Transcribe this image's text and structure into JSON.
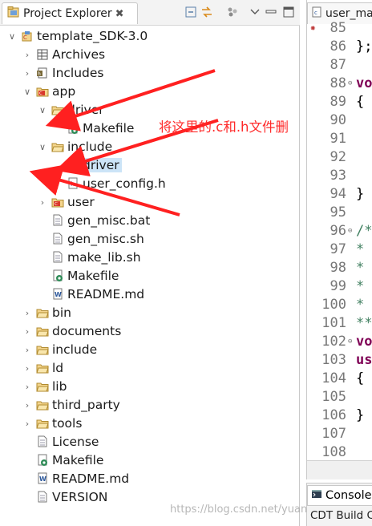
{
  "panel": {
    "title": "Project Explorer",
    "close_glyph": "✖"
  },
  "tree": [
    {
      "label": "template_SDK-3.0",
      "icon": "project-icon",
      "arrow": "∨"
    },
    {
      "label": "Archives",
      "icon": "archives-icon",
      "arrow": "›"
    },
    {
      "label": "Includes",
      "icon": "includes-icon",
      "arrow": "›"
    },
    {
      "label": "app",
      "icon": "source-folder-icon",
      "arrow": "∨"
    },
    {
      "label": "driver",
      "icon": "folder-icon",
      "arrow": "∨"
    },
    {
      "label": "Makefile",
      "icon": "makefile-icon",
      "arrow": ""
    },
    {
      "label": "include",
      "icon": "folder-icon",
      "arrow": "∨"
    },
    {
      "label": "driver",
      "icon": "folder-icon",
      "arrow": ""
    },
    {
      "label": "user_config.h",
      "icon": "header-file-icon",
      "arrow": "›"
    },
    {
      "label": "user",
      "icon": "source-folder-icon",
      "arrow": "›"
    },
    {
      "label": "gen_misc.bat",
      "icon": "file-icon",
      "arrow": ""
    },
    {
      "label": "gen_misc.sh",
      "icon": "file-icon",
      "arrow": ""
    },
    {
      "label": "make_lib.sh",
      "icon": "file-icon",
      "arrow": ""
    },
    {
      "label": "Makefile",
      "icon": "makefile-icon",
      "arrow": ""
    },
    {
      "label": "README.md",
      "icon": "word-file-icon",
      "arrow": ""
    },
    {
      "label": "bin",
      "icon": "folder-icon",
      "arrow": "›"
    },
    {
      "label": "documents",
      "icon": "folder-icon",
      "arrow": "›"
    },
    {
      "label": "include",
      "icon": "folder-icon",
      "arrow": "›"
    },
    {
      "label": "ld",
      "icon": "folder-icon",
      "arrow": "›"
    },
    {
      "label": "lib",
      "icon": "folder-icon",
      "arrow": "›"
    },
    {
      "label": "third_party",
      "icon": "folder-icon",
      "arrow": "›"
    },
    {
      "label": "tools",
      "icon": "folder-icon",
      "arrow": "›"
    },
    {
      "label": "License",
      "icon": "file-icon",
      "arrow": ""
    },
    {
      "label": "Makefile",
      "icon": "makefile-icon",
      "arrow": ""
    },
    {
      "label": "README.md",
      "icon": "word-file-icon",
      "arrow": ""
    },
    {
      "label": "VERSION",
      "icon": "file-icon",
      "arrow": ""
    }
  ],
  "editor": {
    "tab_label": "user_ma",
    "lines": [
      {
        "num": "85",
        "code": ""
      },
      {
        "num": "86",
        "code": "};"
      },
      {
        "num": "87",
        "code": ""
      },
      {
        "num": "88",
        "code": "vo"
      },
      {
        "num": "89",
        "code": "{"
      },
      {
        "num": "90",
        "code": ""
      },
      {
        "num": "91",
        "code": ""
      },
      {
        "num": "92",
        "code": ""
      },
      {
        "num": "93",
        "code": ""
      },
      {
        "num": "94",
        "code": "}"
      },
      {
        "num": "95",
        "code": ""
      },
      {
        "num": "96",
        "code": "/*"
      },
      {
        "num": "97",
        "code": " *"
      },
      {
        "num": "98",
        "code": " *"
      },
      {
        "num": "99",
        "code": " *"
      },
      {
        "num": "100",
        "code": " *"
      },
      {
        "num": "101",
        "code": "**"
      },
      {
        "num": "102",
        "code": "vo"
      },
      {
        "num": "103",
        "code": "us"
      },
      {
        "num": "104",
        "code": "{"
      },
      {
        "num": "105",
        "code": ""
      },
      {
        "num": "106",
        "code": "}"
      },
      {
        "num": "107",
        "code": ""
      },
      {
        "num": "108",
        "code": ""
      }
    ]
  },
  "console": {
    "tab_label": "Console",
    "subtitle": "CDT Build C"
  },
  "annotation": {
    "text": "将这里的.c和.h文件删",
    "color": "#ff2a2a"
  },
  "watermark": "https://blog.csdn.net/yuan"
}
